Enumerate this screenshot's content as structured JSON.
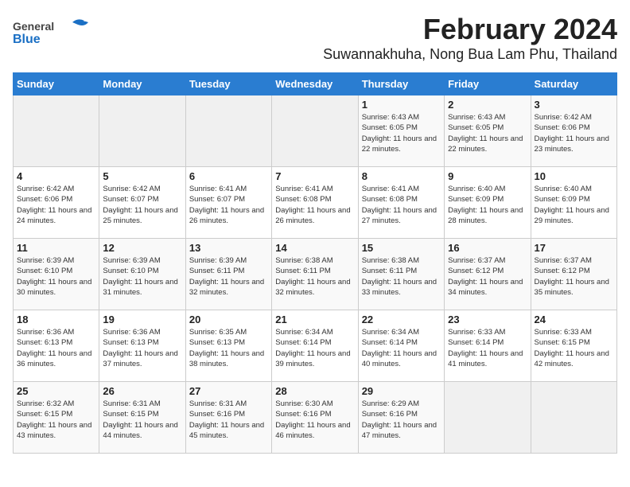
{
  "logo": {
    "general": "General",
    "blue": "Blue"
  },
  "header": {
    "title": "February 2024",
    "subtitle": "Suwannakhuha, Nong Bua Lam Phu, Thailand"
  },
  "weekdays": [
    "Sunday",
    "Monday",
    "Tuesday",
    "Wednesday",
    "Thursday",
    "Friday",
    "Saturday"
  ],
  "weeks": [
    [
      {
        "day": "",
        "detail": ""
      },
      {
        "day": "",
        "detail": ""
      },
      {
        "day": "",
        "detail": ""
      },
      {
        "day": "",
        "detail": ""
      },
      {
        "day": "1",
        "detail": "Sunrise: 6:43 AM\nSunset: 6:05 PM\nDaylight: 11 hours\nand 22 minutes."
      },
      {
        "day": "2",
        "detail": "Sunrise: 6:43 AM\nSunset: 6:05 PM\nDaylight: 11 hours\nand 22 minutes."
      },
      {
        "day": "3",
        "detail": "Sunrise: 6:42 AM\nSunset: 6:06 PM\nDaylight: 11 hours\nand 23 minutes."
      }
    ],
    [
      {
        "day": "4",
        "detail": "Sunrise: 6:42 AM\nSunset: 6:06 PM\nDaylight: 11 hours\nand 24 minutes."
      },
      {
        "day": "5",
        "detail": "Sunrise: 6:42 AM\nSunset: 6:07 PM\nDaylight: 11 hours\nand 25 minutes."
      },
      {
        "day": "6",
        "detail": "Sunrise: 6:41 AM\nSunset: 6:07 PM\nDaylight: 11 hours\nand 26 minutes."
      },
      {
        "day": "7",
        "detail": "Sunrise: 6:41 AM\nSunset: 6:08 PM\nDaylight: 11 hours\nand 26 minutes."
      },
      {
        "day": "8",
        "detail": "Sunrise: 6:41 AM\nSunset: 6:08 PM\nDaylight: 11 hours\nand 27 minutes."
      },
      {
        "day": "9",
        "detail": "Sunrise: 6:40 AM\nSunset: 6:09 PM\nDaylight: 11 hours\nand 28 minutes."
      },
      {
        "day": "10",
        "detail": "Sunrise: 6:40 AM\nSunset: 6:09 PM\nDaylight: 11 hours\nand 29 minutes."
      }
    ],
    [
      {
        "day": "11",
        "detail": "Sunrise: 6:39 AM\nSunset: 6:10 PM\nDaylight: 11 hours\nand 30 minutes."
      },
      {
        "day": "12",
        "detail": "Sunrise: 6:39 AM\nSunset: 6:10 PM\nDaylight: 11 hours\nand 31 minutes."
      },
      {
        "day": "13",
        "detail": "Sunrise: 6:39 AM\nSunset: 6:11 PM\nDaylight: 11 hours\nand 32 minutes."
      },
      {
        "day": "14",
        "detail": "Sunrise: 6:38 AM\nSunset: 6:11 PM\nDaylight: 11 hours\nand 32 minutes."
      },
      {
        "day": "15",
        "detail": "Sunrise: 6:38 AM\nSunset: 6:11 PM\nDaylight: 11 hours\nand 33 minutes."
      },
      {
        "day": "16",
        "detail": "Sunrise: 6:37 AM\nSunset: 6:12 PM\nDaylight: 11 hours\nand 34 minutes."
      },
      {
        "day": "17",
        "detail": "Sunrise: 6:37 AM\nSunset: 6:12 PM\nDaylight: 11 hours\nand 35 minutes."
      }
    ],
    [
      {
        "day": "18",
        "detail": "Sunrise: 6:36 AM\nSunset: 6:13 PM\nDaylight: 11 hours\nand 36 minutes."
      },
      {
        "day": "19",
        "detail": "Sunrise: 6:36 AM\nSunset: 6:13 PM\nDaylight: 11 hours\nand 37 minutes."
      },
      {
        "day": "20",
        "detail": "Sunrise: 6:35 AM\nSunset: 6:13 PM\nDaylight: 11 hours\nand 38 minutes."
      },
      {
        "day": "21",
        "detail": "Sunrise: 6:34 AM\nSunset: 6:14 PM\nDaylight: 11 hours\nand 39 minutes."
      },
      {
        "day": "22",
        "detail": "Sunrise: 6:34 AM\nSunset: 6:14 PM\nDaylight: 11 hours\nand 40 minutes."
      },
      {
        "day": "23",
        "detail": "Sunrise: 6:33 AM\nSunset: 6:14 PM\nDaylight: 11 hours\nand 41 minutes."
      },
      {
        "day": "24",
        "detail": "Sunrise: 6:33 AM\nSunset: 6:15 PM\nDaylight: 11 hours\nand 42 minutes."
      }
    ],
    [
      {
        "day": "25",
        "detail": "Sunrise: 6:32 AM\nSunset: 6:15 PM\nDaylight: 11 hours\nand 43 minutes."
      },
      {
        "day": "26",
        "detail": "Sunrise: 6:31 AM\nSunset: 6:15 PM\nDaylight: 11 hours\nand 44 minutes."
      },
      {
        "day": "27",
        "detail": "Sunrise: 6:31 AM\nSunset: 6:16 PM\nDaylight: 11 hours\nand 45 minutes."
      },
      {
        "day": "28",
        "detail": "Sunrise: 6:30 AM\nSunset: 6:16 PM\nDaylight: 11 hours\nand 46 minutes."
      },
      {
        "day": "29",
        "detail": "Sunrise: 6:29 AM\nSunset: 6:16 PM\nDaylight: 11 hours\nand 47 minutes."
      },
      {
        "day": "",
        "detail": ""
      },
      {
        "day": "",
        "detail": ""
      }
    ]
  ]
}
